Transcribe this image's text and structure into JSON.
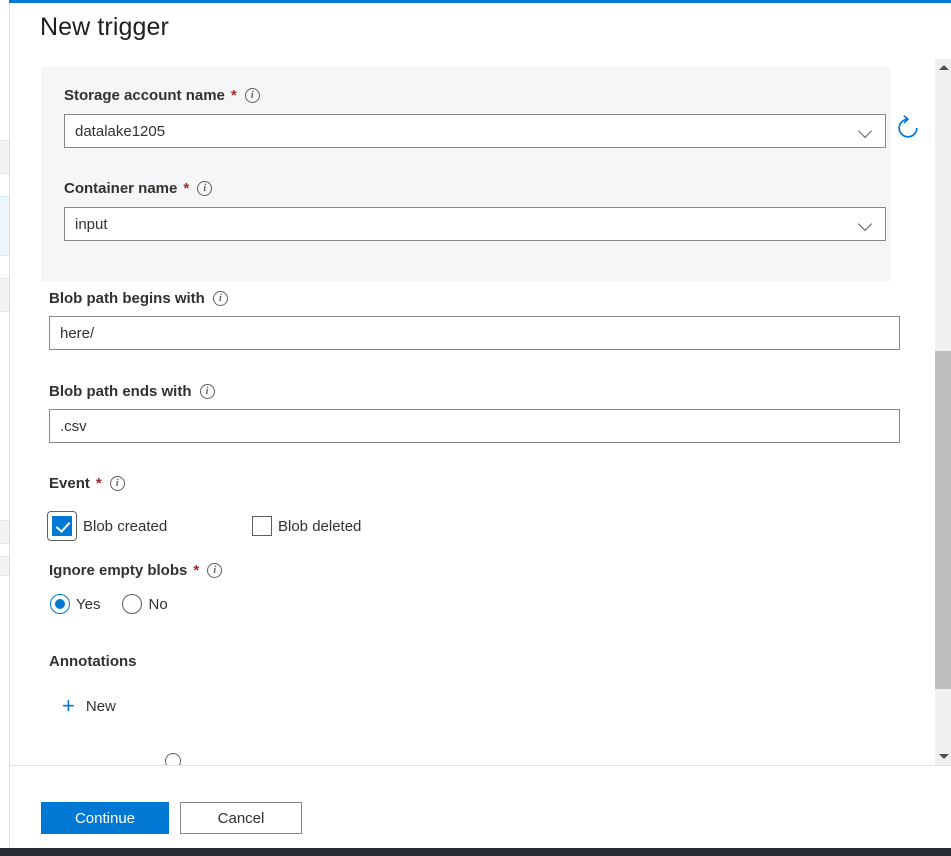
{
  "dialog": {
    "title": "New trigger",
    "accent_color": "#0078d4"
  },
  "fields": {
    "storage_account": {
      "label": "Storage account name",
      "required_marker": "*",
      "info_icon": "info-icon",
      "value": "datalake1205",
      "chevron_icon": "chevron-down-icon",
      "refresh_icon": "refresh-icon"
    },
    "container": {
      "label": "Container name",
      "required_marker": "*",
      "info_icon": "info-icon",
      "value": "input",
      "chevron_icon": "chevron-down-icon"
    },
    "blob_path_begins": {
      "label": "Blob path begins with",
      "info_icon": "info-icon",
      "value": "here/"
    },
    "blob_path_ends": {
      "label": "Blob path ends with",
      "info_icon": "info-icon",
      "value": ".csv"
    },
    "event": {
      "label": "Event",
      "required_marker": "*",
      "info_icon": "info-icon",
      "options": [
        {
          "label": "Blob created",
          "checked": true
        },
        {
          "label": "Blob deleted",
          "checked": false
        }
      ]
    },
    "ignore_empty_blobs": {
      "label": "Ignore empty blobs",
      "required_marker": "*",
      "info_icon": "info-icon",
      "options": [
        {
          "label": "Yes",
          "selected": true
        },
        {
          "label": "No",
          "selected": false
        }
      ]
    }
  },
  "annotations": {
    "heading": "Annotations",
    "add_label": "New",
    "add_icon": "plus-icon"
  },
  "scrollbar": {
    "up_icon": "caret-up-icon",
    "down_icon": "caret-down-icon"
  },
  "footer": {
    "continue_label": "Continue",
    "cancel_label": "Cancel"
  }
}
